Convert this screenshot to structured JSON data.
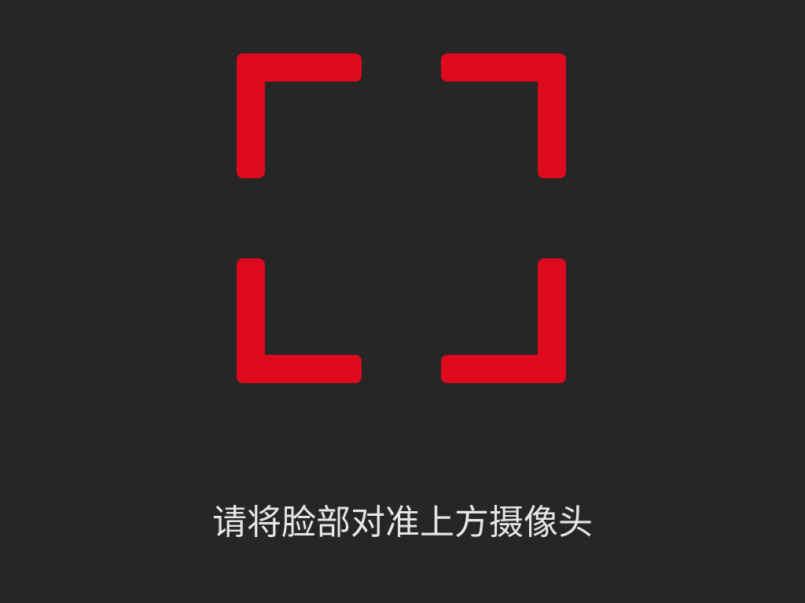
{
  "colors": {
    "background": "#262626",
    "accent": "#dc0a1c",
    "text": "#e6e6e6"
  },
  "scanner": {
    "icon": "face-scan-frame-icon"
  },
  "prompt": {
    "instruction": "请将脸部对准上方摄像头"
  }
}
